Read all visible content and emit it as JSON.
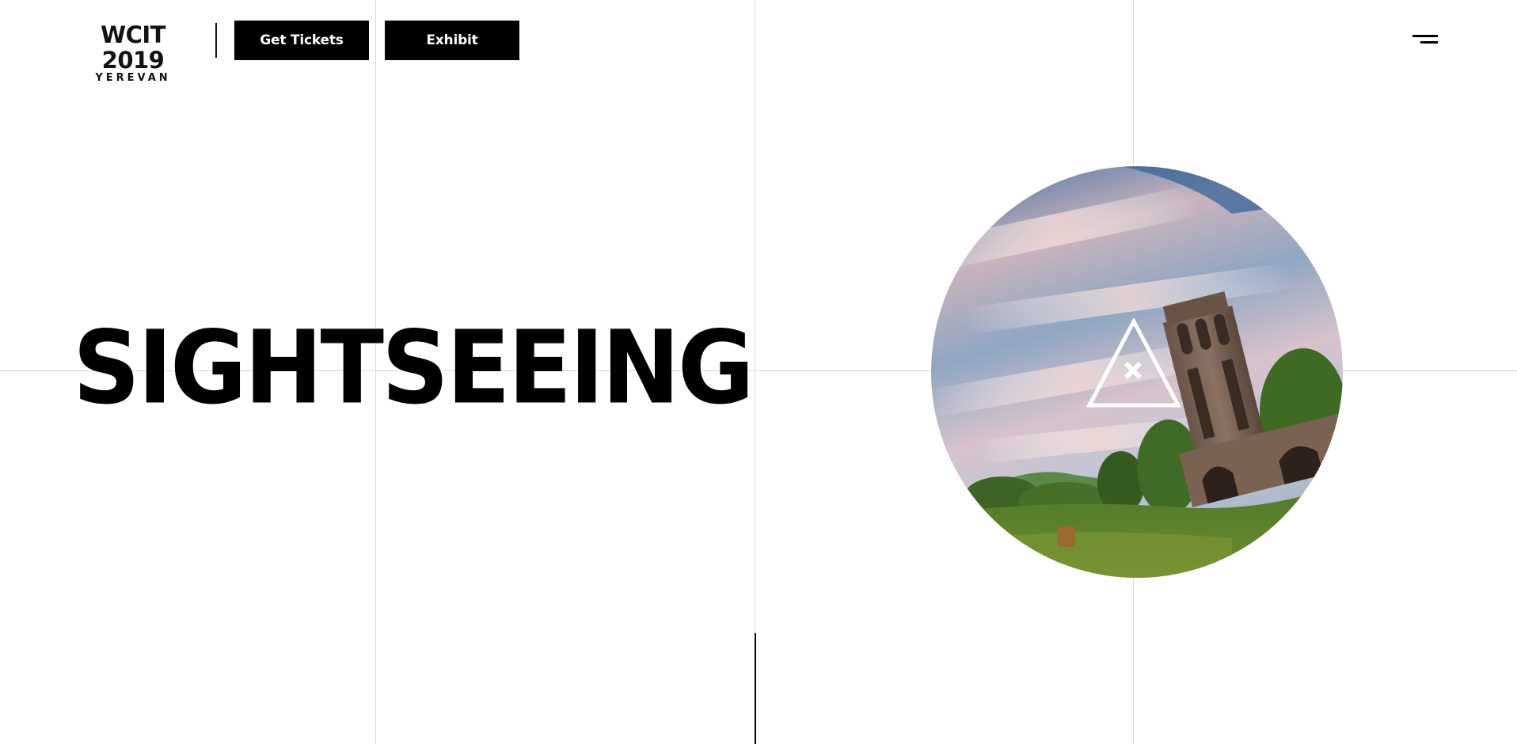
{
  "header": {
    "logo": {
      "title": "WCIT 2019",
      "subtitle": "YEREVAN"
    },
    "buttons": {
      "tickets": "Get Tickets",
      "exhibit": "Exhibit"
    },
    "menu_icon": "hamburger-menu-icon"
  },
  "hero": {
    "title": "SIGHTSEEING",
    "image_icon": "close-icon",
    "image_marker_icon": "triangle-icon"
  },
  "colors": {
    "primary": "#000000",
    "background": "#ffffff",
    "grid_lines": "#d9d9d9"
  }
}
